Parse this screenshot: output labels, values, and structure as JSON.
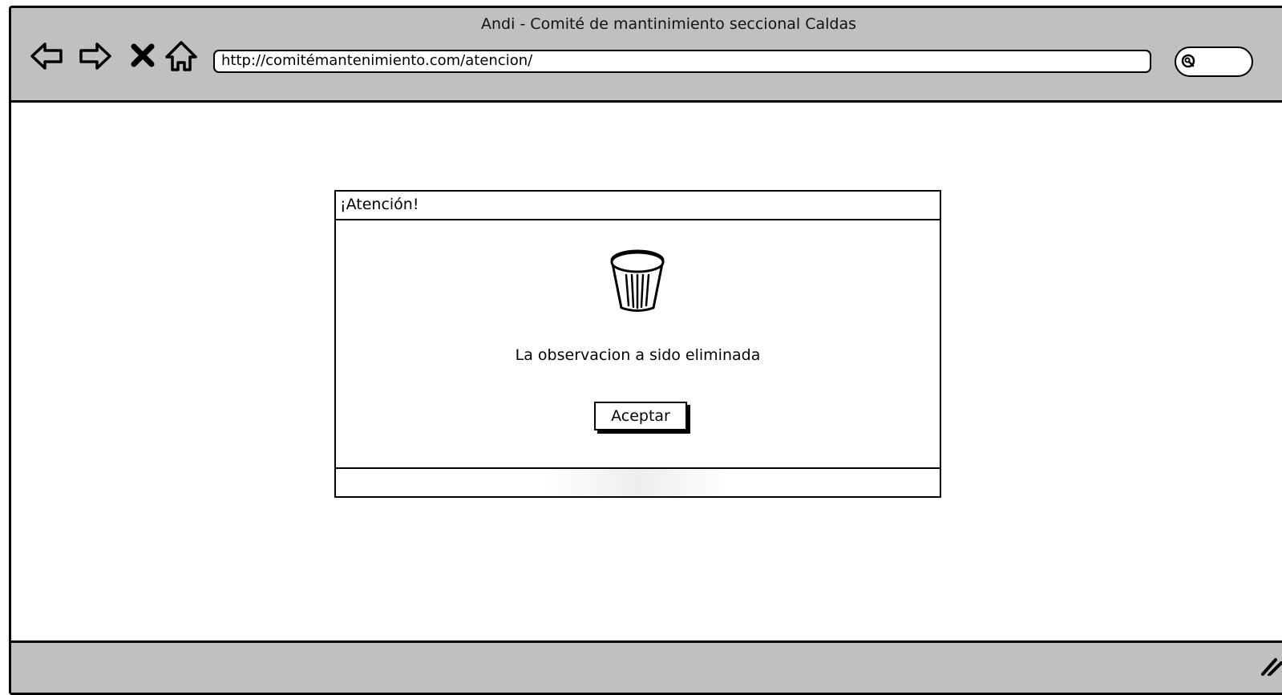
{
  "browser": {
    "window_title": "Andi - Comité de mantinimiento seccional Caldas",
    "url": "http://comitémantenimiento.com/atencion/",
    "nav_icons": [
      "back-arrow-icon",
      "forward-arrow-icon",
      "close-x-icon",
      "home-icon"
    ],
    "search_icon": "search-icon"
  },
  "dialog": {
    "title": "¡Atención!",
    "icon": "trash-can-icon",
    "message": "La observacion a sido eliminada",
    "accept_label": "Aceptar"
  },
  "colors": {
    "chrome_gray": "#c0c0c0",
    "background": "#ffffff",
    "stroke": "#000000"
  }
}
